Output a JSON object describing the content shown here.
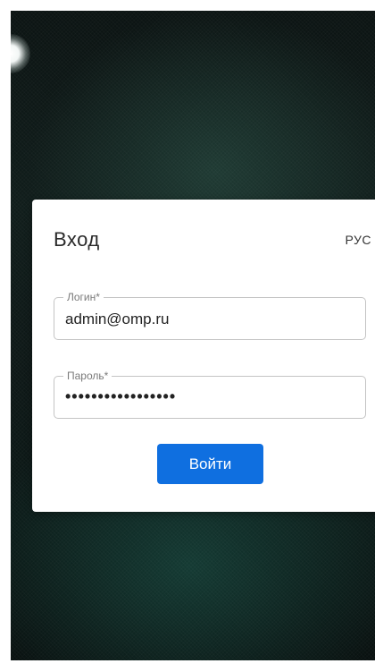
{
  "login_card": {
    "title": "Вход",
    "language": "РУС",
    "login": {
      "label": "Логин*",
      "value": "admin@omp.ru"
    },
    "password": {
      "label": "Пароль*",
      "value": "•••••••••••••••••"
    },
    "submit_label": "Войти"
  },
  "colors": {
    "accent": "#0f6fe0",
    "background_dark": "#0c1413",
    "card": "#ffffff"
  }
}
